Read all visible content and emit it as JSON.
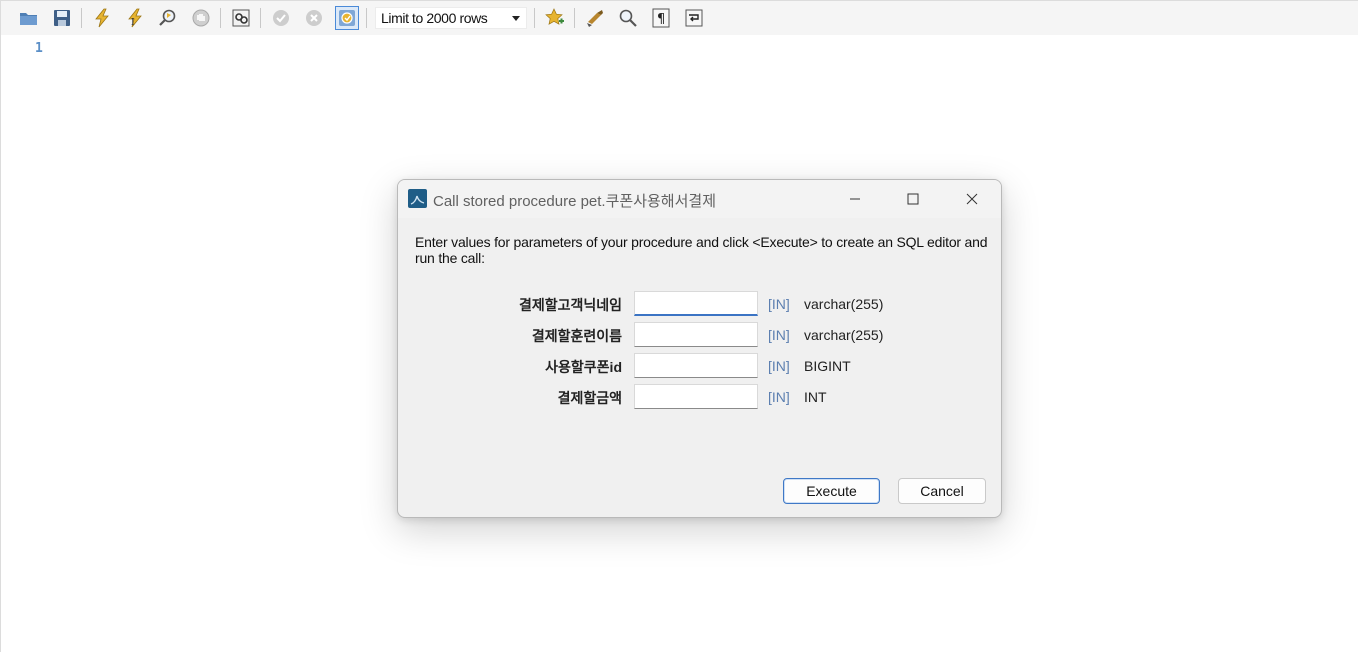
{
  "toolbar": {
    "buttons": [
      {
        "icon": "open-folder-icon"
      },
      {
        "icon": "save-icon"
      },
      {
        "icon": "execute-lightning-icon"
      },
      {
        "icon": "execute-current-icon"
      },
      {
        "icon": "explain-magnifier-icon"
      },
      {
        "icon": "stop-icon"
      },
      {
        "icon": "toggle-results-icon"
      },
      {
        "icon": "commit-icon"
      },
      {
        "icon": "rollback-icon"
      },
      {
        "icon": "autocommit-icon"
      }
    ],
    "limit_label": "Limit to 2000 rows",
    "buttons_right": [
      {
        "icon": "add-snippet-icon"
      },
      {
        "icon": "beautify-brush-icon"
      },
      {
        "icon": "find-icon"
      },
      {
        "icon": "invisible-chars-icon"
      },
      {
        "icon": "wrap-lines-icon"
      }
    ]
  },
  "editor": {
    "line_numbers": [
      "1"
    ]
  },
  "dialog": {
    "title": "Call stored procedure pet.쿠폰사용해서결제",
    "description": "Enter values for parameters of your procedure and click <Execute> to create an SQL editor and run the call:",
    "params": [
      {
        "name": "결제할고객닉네임",
        "value": "",
        "mode": "[IN]",
        "type": "varchar(255)"
      },
      {
        "name": "결제할훈련이름",
        "value": "",
        "mode": "[IN]",
        "type": "varchar(255)"
      },
      {
        "name": "사용할쿠폰id",
        "value": "",
        "mode": "[IN]",
        "type": "BIGINT"
      },
      {
        "name": "결제할금액",
        "value": "",
        "mode": "[IN]",
        "type": "INT"
      }
    ],
    "execute_label": "Execute",
    "cancel_label": "Cancel"
  },
  "colors": {
    "accent": "#3f78c6",
    "mode_text": "#5c7fb0",
    "line_number": "#5b8fc7"
  }
}
